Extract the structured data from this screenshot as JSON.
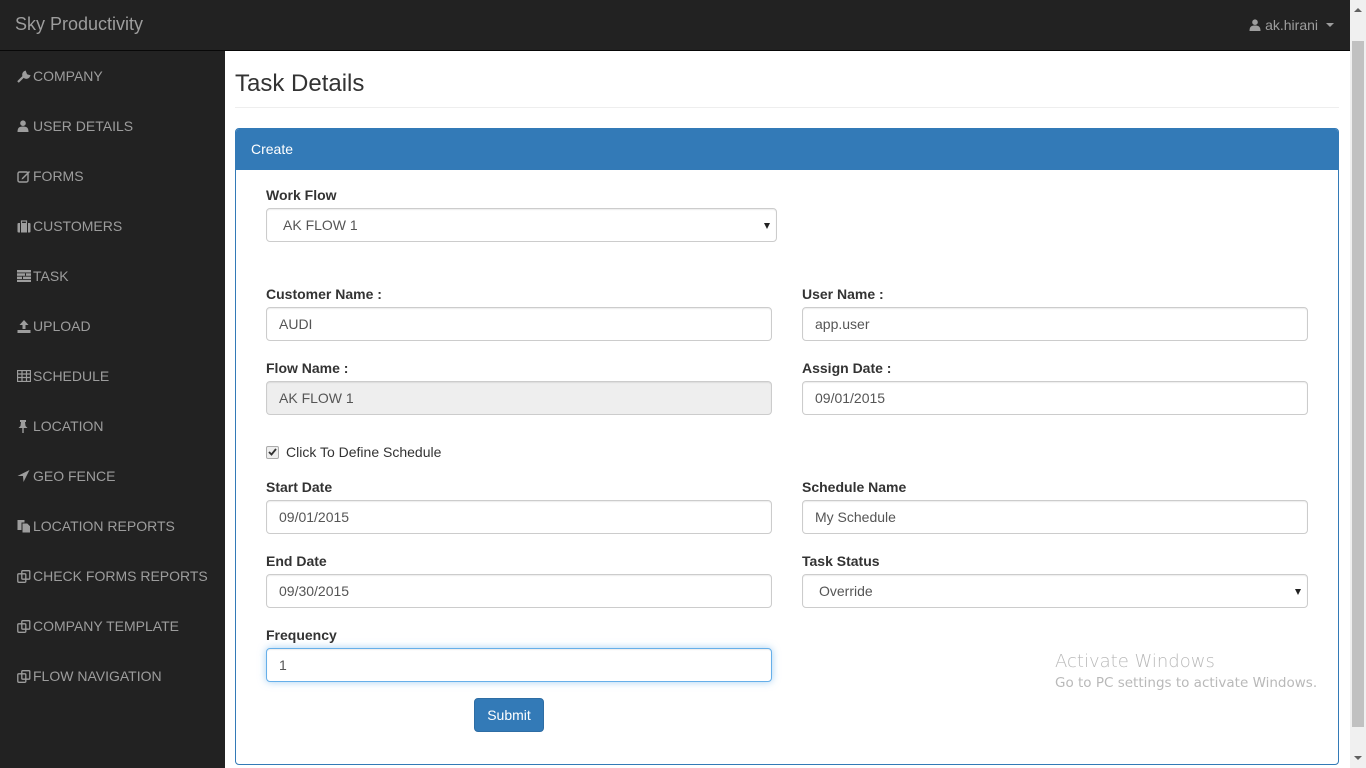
{
  "navbar": {
    "brand": "Sky Productivity",
    "user": "ak.hirani"
  },
  "sidebar": {
    "items": [
      {
        "label": "COMPANY",
        "icon": "wrench-icon"
      },
      {
        "label": "USER DETAILS",
        "icon": "user-icon"
      },
      {
        "label": "FORMS",
        "icon": "edit-icon"
      },
      {
        "label": "CUSTOMERS",
        "icon": "briefcase-icon"
      },
      {
        "label": "TASK",
        "icon": "tasks-icon"
      },
      {
        "label": "UPLOAD",
        "icon": "upload-icon"
      },
      {
        "label": "SCHEDULE",
        "icon": "table-icon"
      },
      {
        "label": "LOCATION",
        "icon": "pushpin-icon"
      },
      {
        "label": "GEO FENCE",
        "icon": "location-arrow-icon"
      },
      {
        "label": "LOCATION REPORTS",
        "icon": "copy-icon"
      },
      {
        "label": "CHECK FORMS REPORTS",
        "icon": "duplicate-icon"
      },
      {
        "label": "COMPANY TEMPLATE",
        "icon": "duplicate-icon"
      },
      {
        "label": "FLOW NAVIGATION",
        "icon": "duplicate-icon"
      }
    ]
  },
  "page": {
    "title": "Task Details"
  },
  "panel": {
    "heading": "Create"
  },
  "form": {
    "workflow": {
      "label": "Work Flow",
      "value": "AK FLOW 1"
    },
    "customer_name": {
      "label": "Customer Name :",
      "value": "AUDI"
    },
    "user_name": {
      "label": "User Name :",
      "value": "app.user"
    },
    "flow_name": {
      "label": "Flow Name :",
      "value": "AK FLOW 1"
    },
    "assign_date": {
      "label": "Assign Date :",
      "value": "09/01/2015"
    },
    "define_schedule": {
      "label": "Click To Define Schedule",
      "checked": true
    },
    "start_date": {
      "label": "Start Date",
      "value": "09/01/2015"
    },
    "schedule_name": {
      "label": "Schedule Name",
      "value": "My Schedule"
    },
    "end_date": {
      "label": "End Date",
      "value": "09/30/2015"
    },
    "task_status": {
      "label": "Task Status",
      "value": "Override"
    },
    "frequency": {
      "label": "Frequency",
      "value": "1"
    },
    "submit_label": "Submit"
  },
  "watermark": {
    "title": "Activate Windows",
    "subtitle": "Go to PC settings to activate Windows."
  },
  "colors": {
    "primary": "#337ab7",
    "navbar": "#222222",
    "nav_text": "#9d9d9d"
  }
}
